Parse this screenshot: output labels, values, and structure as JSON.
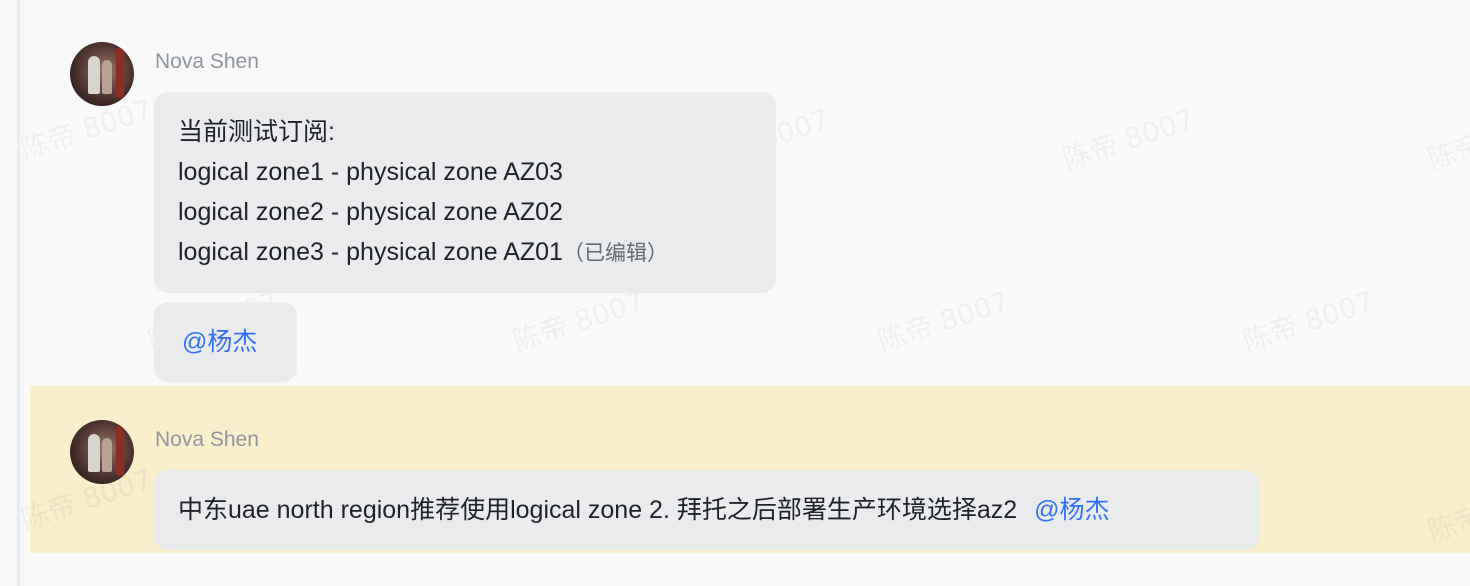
{
  "messages": [
    {
      "sender": "Nova Shen",
      "lines": [
        "当前测试订阅:",
        "logical zone1 - physical zone AZ03",
        "logical zone2 - physical zone AZ02",
        "logical zone3 - physical zone AZ01"
      ],
      "edited_label": "（已编辑）",
      "mention": "@杨杰"
    },
    {
      "sender": "Nova Shen",
      "text": "中东uae north region推荐使用logical zone 2. 拜托之后部署生产环境选择az2",
      "mention": "@杨杰",
      "highlighted": true
    }
  ],
  "watermark": "陈帝 8007",
  "colors": {
    "highlight": "#f9efca",
    "bubble": "#eaebed",
    "mention": "#3370ff",
    "sender": "#8f959e"
  }
}
